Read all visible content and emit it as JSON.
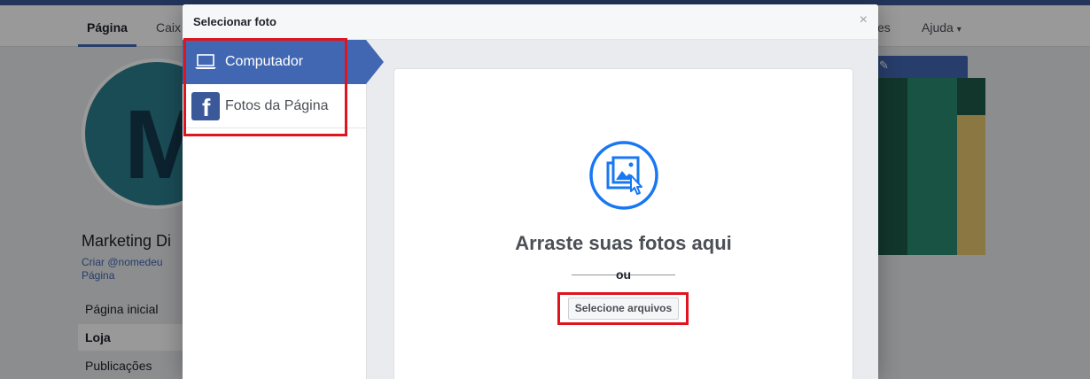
{
  "background": {
    "nav": {
      "items": [
        "Página",
        "Caix",
        "es",
        "Ajuda"
      ],
      "help_caret": "▾"
    },
    "page": {
      "avatar_letter": "M",
      "name": "Marketing Di",
      "handle_line1": "Criar @nomedeu",
      "handle_line2": "Página",
      "side_links": [
        "Página inicial",
        "Loja",
        "Publicações"
      ],
      "edit_icon": "✎"
    }
  },
  "modal": {
    "title": "Selecionar foto",
    "close_label": "×",
    "sidebar": {
      "items": [
        {
          "label": "Computador",
          "icon": "laptop-icon",
          "active": true
        },
        {
          "label": "Fotos da Página",
          "icon": "facebook-icon",
          "active": false
        }
      ],
      "facebook_glyph": "f"
    },
    "dropzone": {
      "icon": "upload-photos-icon",
      "title": "Arraste suas fotos aqui",
      "or_text": "ou",
      "button_label": "Selecione arquivos"
    }
  },
  "colors": {
    "brand": "#4267b2",
    "highlight": "#e0141e",
    "upload_icon": "#1877f2"
  }
}
